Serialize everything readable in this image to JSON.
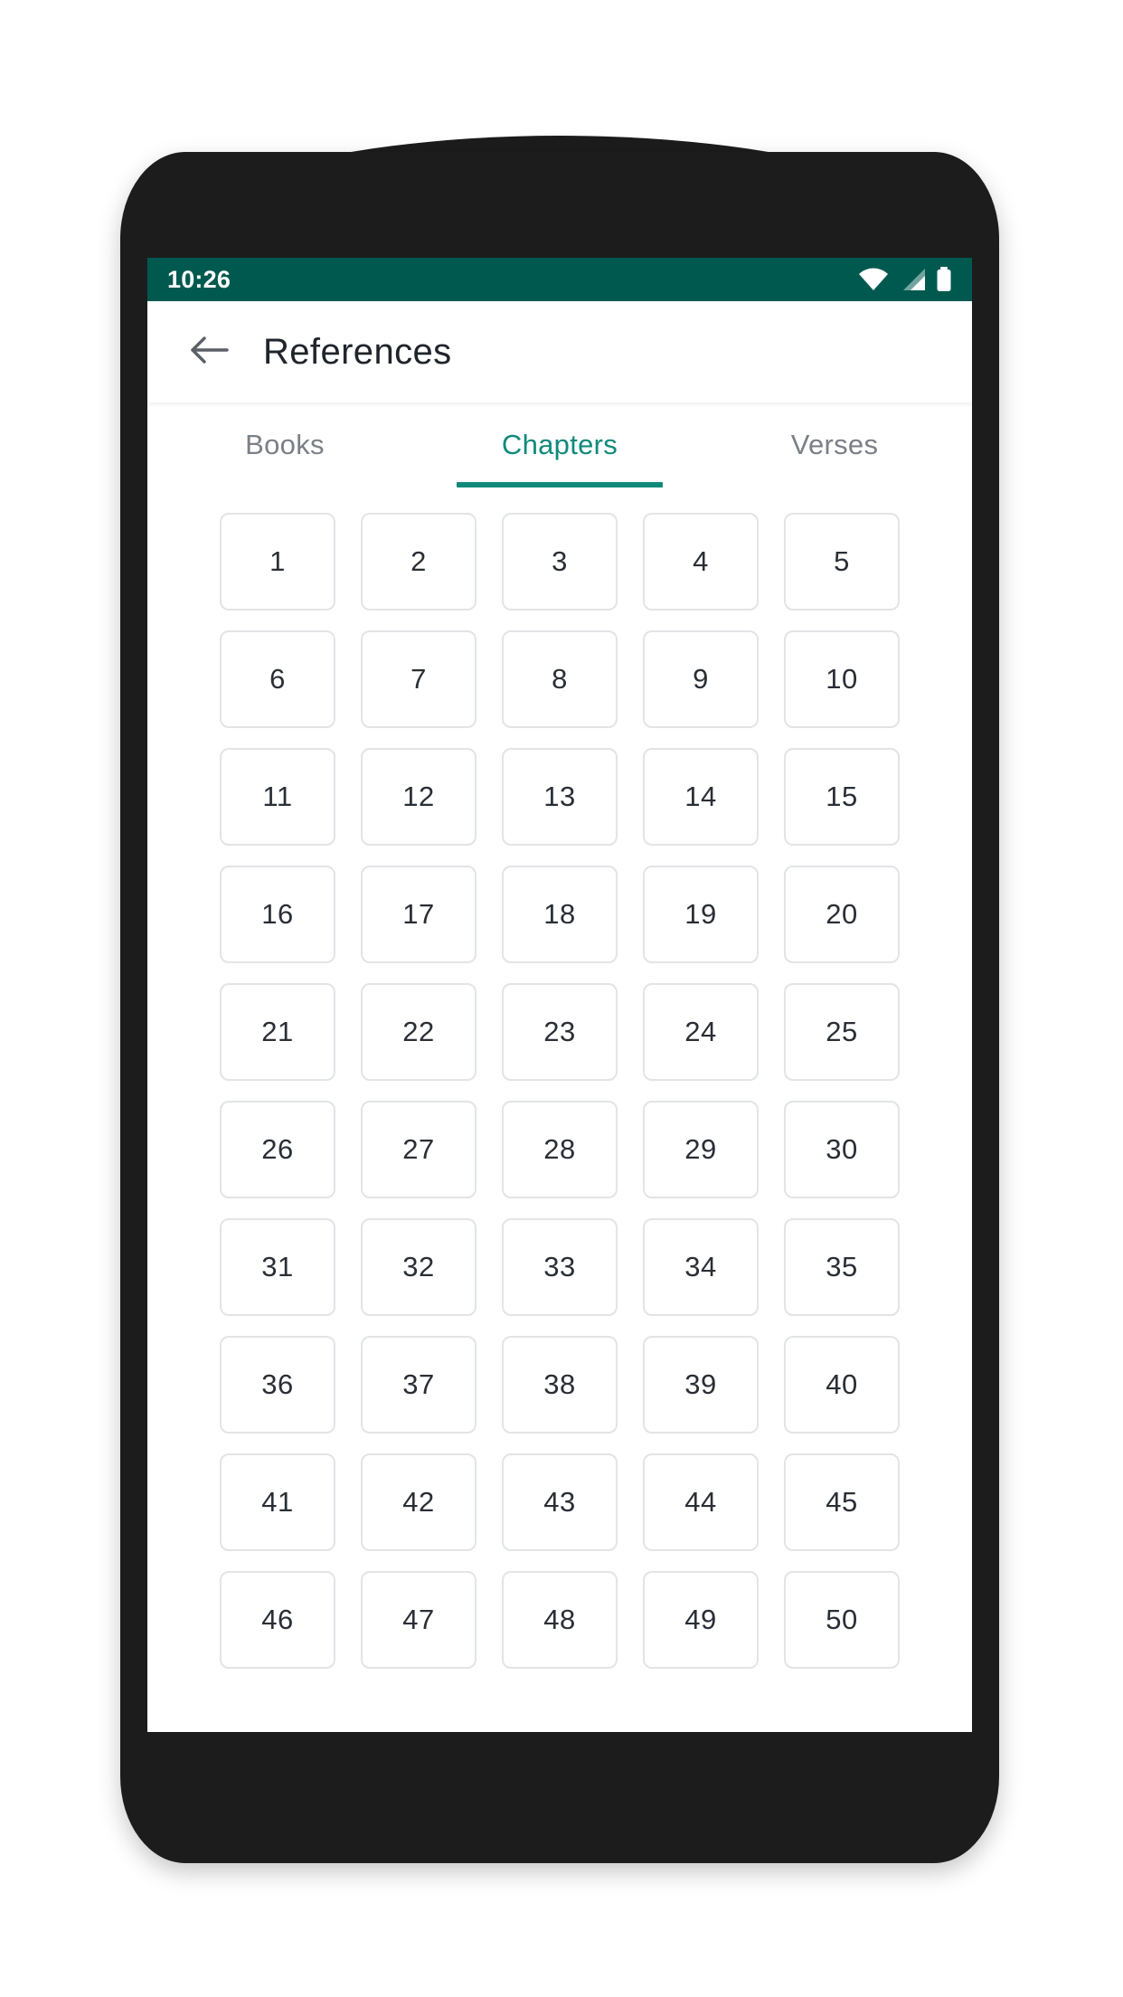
{
  "status_bar": {
    "time": "10:26",
    "icons": [
      {
        "name": "wifi-icon",
        "label": "wifi-full"
      },
      {
        "name": "cellular-signal-icon",
        "label": "signal-partial"
      },
      {
        "name": "battery-icon",
        "label": "battery-full"
      }
    ],
    "background_color": "#00594f",
    "foreground_color": "#ffffff"
  },
  "app_bar": {
    "back_icon": "arrow-left-icon",
    "title": "References"
  },
  "tabs": {
    "items": [
      {
        "label": "Books",
        "active": false
      },
      {
        "label": "Chapters",
        "active": true
      },
      {
        "label": "Verses",
        "active": false
      }
    ],
    "active_index": 1,
    "active_color": "#0f8a7a",
    "inactive_color": "#7b7f86"
  },
  "chapter_grid": {
    "columns": 5,
    "rows": 10,
    "cells": [
      "1",
      "2",
      "3",
      "4",
      "5",
      "6",
      "7",
      "8",
      "9",
      "10",
      "11",
      "12",
      "13",
      "14",
      "15",
      "16",
      "17",
      "18",
      "19",
      "20",
      "21",
      "22",
      "23",
      "24",
      "25",
      "26",
      "27",
      "28",
      "29",
      "30",
      "31",
      "32",
      "33",
      "34",
      "35",
      "36",
      "37",
      "38",
      "39",
      "40",
      "41",
      "42",
      "43",
      "44",
      "45",
      "46",
      "47",
      "48",
      "49",
      "50"
    ],
    "cell_border_color": "#e2e4e6",
    "cell_text_color": "#2a2e35"
  },
  "device": {
    "frame_color": "#1c1c1c",
    "screen_background": "#ffffff"
  }
}
